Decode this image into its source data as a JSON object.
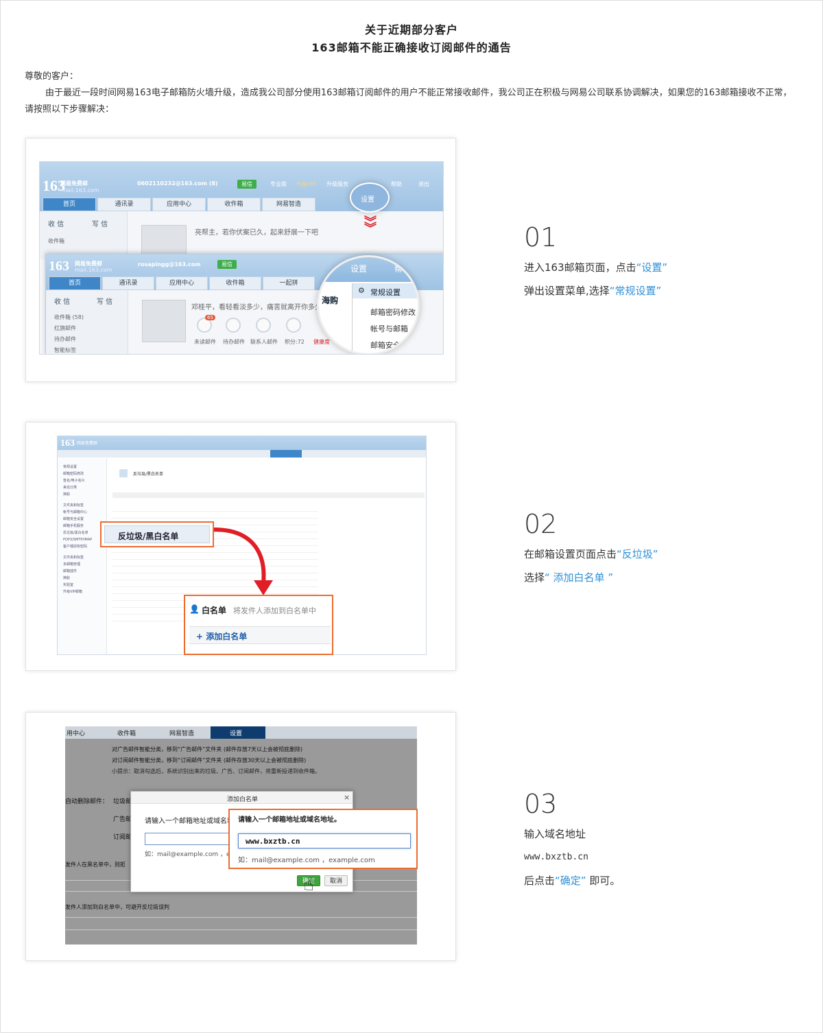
{
  "notice": {
    "title_line1": "关于近期部分客户",
    "title_line2": "163邮箱不能正确接收订阅邮件的通告",
    "greeting": "尊敬的客户：",
    "body": "由于最近一段时间网易163电子邮箱防火墙升级，造成我公司部分使用163邮箱订阅邮件的用户不能正常接收邮件，我公司正在积极与网易公司联系协调解决，如果您的163邮箱接收不正常，请按照以下步骤解决："
  },
  "steps": [
    {
      "number": "01",
      "line1_prefix": "进入163邮箱页面，点击",
      "line1_highlight": "“设置”",
      "line2_prefix": "弹出设置菜单,选择",
      "line2_highlight": "“常规设置”"
    },
    {
      "number": "02",
      "line1_prefix": "在邮箱设置页面点击",
      "line1_highlight": "“反垃圾”",
      "line2_prefix": "选择",
      "line2_highlight": "“ 添加白名单 ”"
    },
    {
      "number": "03",
      "line1": "输入域名地址",
      "domain": "www.bxztb.cn",
      "line3_prefix": "后点击",
      "line3_highlight": "“确定”",
      "line3_suffix": " 即可。"
    }
  ],
  "shot1": {
    "logo": "163",
    "logo_sub": "网易免费邮",
    "logo_url": "mail.163.com",
    "account1": "0602110232@163.com (8)",
    "account2": "rosapingg@163.com",
    "yixin": "易信",
    "links": [
      "专业版",
      "升级VIP",
      "升级服务",
      "帮助",
      "退出"
    ],
    "tabs": [
      "首页",
      "通讯录",
      "应用中心",
      "收件箱",
      "网易智造"
    ],
    "tabs2": [
      "首页",
      "通讯录",
      "应用中心",
      "收件箱",
      "一起拼"
    ],
    "receive": "收 信",
    "write": "写 信",
    "inbox": "收件箱",
    "inbox_count": "收件箱 (58)",
    "side_items": [
      "红旗邮件",
      "待办邮件",
      "智能标签"
    ],
    "greet1": "亮帮主，若你伏案已久，起来舒展一下吧",
    "greet2": "邓桂平，看轻看淡多少，痛苦就离开你多少",
    "icons_labels": [
      "未读邮件",
      "待办邮件",
      "联系人邮件",
      "积分:72",
      "健康度"
    ],
    "badge": "65",
    "settings_btn": "设置",
    "menu_title": "设置",
    "menu_items": [
      "常规设置",
      "邮箱密码修改",
      "帐号与邮箱",
      "邮箱安全"
    ],
    "haigou": "海购",
    "help_short": "帮"
  },
  "shot2": {
    "logo": "163",
    "logo_sub": "网易免费邮",
    "left_items": [
      "常规设置",
      "邮箱密码修改",
      "签名/电子名片",
      "来信分类",
      "换肤",
      "文件夹和标签",
      "帐号与邮箱中心",
      "邮箱安全设置",
      "邮箱手机服务",
      "反垃圾/黑白名单",
      "POP3/SMTP/IMAP",
      "客户端授权密码",
      "文件夹和标签",
      "多邮箱管理",
      "邮箱插件",
      "换肤",
      "实验室",
      "升级VIP邮箱"
    ],
    "section": "反垃圾/黑白名单",
    "callout_left": "反垃圾/黑白名单",
    "whitelist_title": "白名单",
    "whitelist_desc": "将发件人添加到白名单中",
    "add_whitelist": "+ 添加白名单"
  },
  "shot3": {
    "tabs": [
      "用中心",
      "收件箱",
      "网易智造",
      "设置"
    ],
    "check1": "对广告邮件智能分类，移到“广告邮件”文件夹 (邮件存放7天以上会被彻底删除)",
    "check2": "对订阅邮件智能分类，移到“订阅邮件”文件夹 (邮件存放30天以上会被彻底删除)",
    "tip": "小提示：取消勾选后，系统识别出来的垃圾、广告、订阅邮件，将重新投递到收件箱。",
    "auto_delete": "自动删除邮件：",
    "trash": "垃圾邮",
    "ad": "广告邮",
    "sub": "订阅邮",
    "black_note": "发件人在黑名单中，则拒",
    "white_note": "发件人添加到白名单中，可避开反垃圾误判",
    "dialog_title": "添加白名单",
    "dialog_prompt": "请输入一个邮箱地址或域名地",
    "dialog_example": "如：mail@example.com ，e",
    "callout_prompt": "请输入一个邮箱地址或域名地址。",
    "callout_value": "www.bxztb.cn",
    "callout_example": "如：mail@example.com ，example.com",
    "ok": "确定",
    "cancel": "取消"
  }
}
